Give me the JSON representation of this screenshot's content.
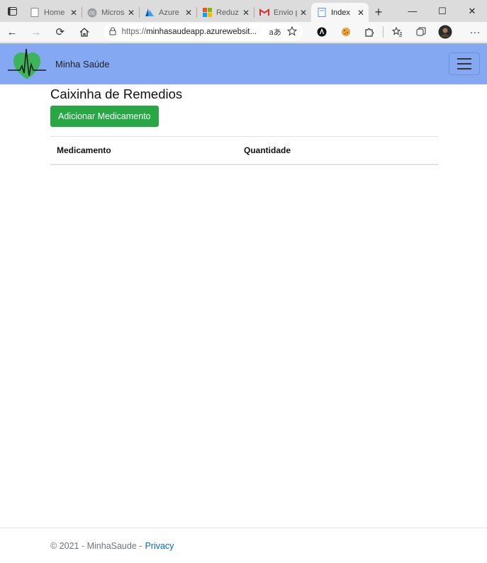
{
  "browser": {
    "tabs": [
      {
        "title": "Home",
        "icon": "page-icon"
      },
      {
        "title": "Micros",
        "icon": "ce-icon"
      },
      {
        "title": "Azure",
        "icon": "azure-icon"
      },
      {
        "title": "Reduz",
        "icon": "microsoft-icon"
      },
      {
        "title": "Envio p",
        "icon": "gmail-icon"
      },
      {
        "title": "Index",
        "icon": "page-icon",
        "active": true
      }
    ],
    "address": {
      "protocol": "https://",
      "host": "minhasaudeapp.azurewebsit...",
      "read_aloud": "aあ"
    }
  },
  "navbar": {
    "brand": "Minha Saúde",
    "bg_color": "#84a9f2"
  },
  "main": {
    "title": "Caixinha de Remedios",
    "add_button": "Adicionar Medicamento",
    "table": {
      "headers": [
        "Medicamento",
        "Quantidade"
      ],
      "rows": []
    }
  },
  "footer": {
    "text": "© 2021 - MinhaSaude -",
    "privacy_link": "Privacy"
  }
}
